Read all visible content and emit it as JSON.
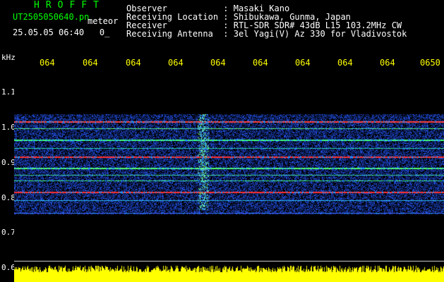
{
  "header": {
    "title": "HROFFT",
    "filename": "UT2505050640.pn",
    "tag": "meteor",
    "datetime": "25.05.05 06:40",
    "datetime_suffix": "0_",
    "observer_label": "Observer",
    "observer_value": ": Masaki Kano",
    "location_label": "Receiving Location",
    "location_value": ": Shibukawa, Gunma, Japan",
    "receiver_label": "Receiver",
    "receiver_value": ": RTL-SDR SDR# 43dB L15 103.2MHz CW",
    "antenna_label": "Receiving Antenna",
    "antenna_value": ": 3el Yagi(V) Az 330 for Vladivostok"
  },
  "time_axis": {
    "ticks": [
      "064",
      "064",
      "064",
      "064",
      "064",
      "064",
      "064",
      "064",
      "064",
      "0650"
    ]
  },
  "freq_axis": {
    "unit": "kHz",
    "labels": [
      "1.1",
      "1.0",
      "0.9",
      "0.8",
      "0.7",
      "0.6"
    ]
  },
  "colors": {
    "background": "#000000",
    "header_green": "#00ff00",
    "header_white": "#ffffff",
    "tick_yellow": "#ffff00",
    "noise_blue": "#1f3fff",
    "signal_green": "#40ff80",
    "strong_red": "#ff3030",
    "power_yellow": "#ffff00"
  }
}
